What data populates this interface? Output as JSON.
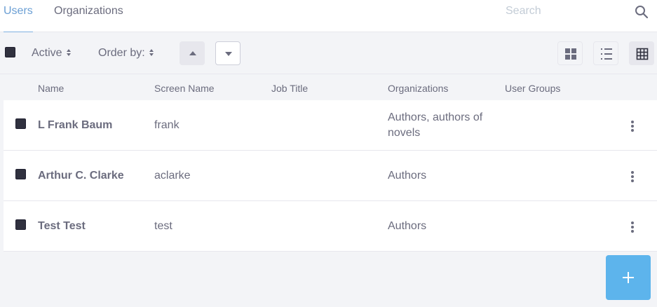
{
  "nav": {
    "tabs": [
      {
        "label": "Users",
        "active": true
      },
      {
        "label": "Organizations",
        "active": false
      }
    ],
    "search": {
      "placeholder": "Search",
      "value": "",
      "icon": "search-icon"
    }
  },
  "toolbar": {
    "filter_label": "Active",
    "order_label": "Order by:",
    "sort_asc_icon": "caret-up-icon",
    "sort_desc_icon": "caret-down-icon",
    "view_modes": [
      "cards-icon",
      "list-icon",
      "table-icon"
    ],
    "active_view": "table"
  },
  "table": {
    "columns": [
      "Name",
      "Screen Name",
      "Job Title",
      "Organizations",
      "User Groups"
    ],
    "rows": [
      {
        "name": "L Frank Baum",
        "screen_name": "frank",
        "job_title": "",
        "organizations": "Authors, authors of novels",
        "user_groups": ""
      },
      {
        "name": "Arthur C. Clarke",
        "screen_name": "aclarke",
        "job_title": "",
        "organizations": "Authors",
        "user_groups": ""
      },
      {
        "name": "Test Test",
        "screen_name": "test",
        "job_title": "",
        "organizations": "Authors",
        "user_groups": ""
      }
    ]
  },
  "fab": {
    "icon": "plus-icon"
  },
  "colors": {
    "accent": "#6b9fd4",
    "primary_button": "#5db4ec",
    "text": "#6b6c7e",
    "background": "#f3f4f7"
  }
}
